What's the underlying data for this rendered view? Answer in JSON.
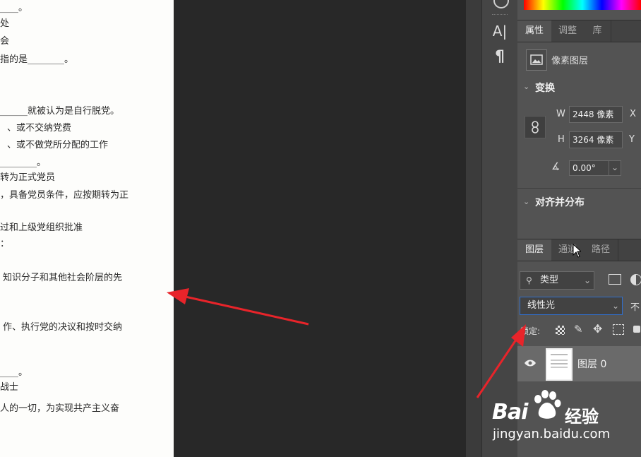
{
  "document": {
    "lines": [
      "____。",
      "处",
      "会",
      "指的是________。",
      "______就被认为是自行脱党。",
      "、或不交纳党费",
      "、或不做党所分配的工作",
      "________。",
      "转为正式党员",
      "，具备党员条件，应按期转为正",
      "过和上级党组织批准",
      "：",
      "知识分子和其他社会阶层的先",
      "作、执行党的决议和按时交纳",
      "____。",
      "战士",
      "人的一切，为实现共产主义奋"
    ]
  },
  "sidebar": {
    "type_tool_glyph": "A|",
    "paragraph_glyph": "¶"
  },
  "properties_panel": {
    "tabs": [
      "属性",
      "调整",
      "库"
    ],
    "layer_kind": "像素图层",
    "transform_title": "变换",
    "w_label": "W",
    "w_value": "2448 像素",
    "h_label": "H",
    "h_value": "3264 像素",
    "x_label": "X",
    "y_label": "Y",
    "angle_value": "0.00°",
    "align_title": "对齐并分布"
  },
  "layers_panel": {
    "tabs": [
      "图层",
      "通道",
      "路径"
    ],
    "filter_kind": "类型",
    "blend_mode": "线性光",
    "opacity_label": "不",
    "lock_label": "锁定:",
    "layer_name": "图层 0"
  },
  "watermark": {
    "brand": "Bai",
    "brand_suffix": "经验",
    "url": "jingyan.baidu.com"
  },
  "colors": {
    "panel_bg": "#535353",
    "arrow": "#e8242a",
    "active_field_border": "#2f6fd0"
  }
}
